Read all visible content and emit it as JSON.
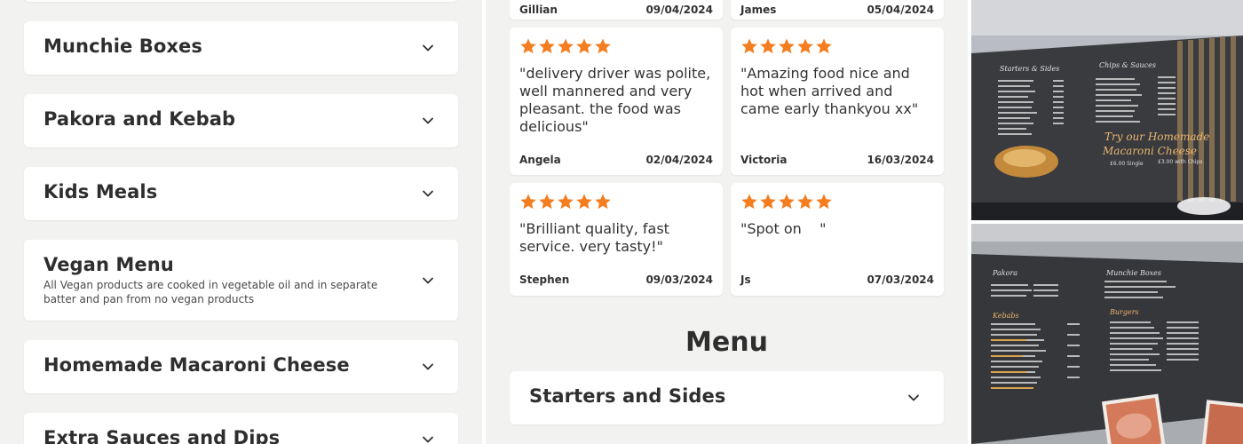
{
  "categories": [
    {
      "title": "Munchie Boxes"
    },
    {
      "title": "Pakora and Kebab"
    },
    {
      "title": "Kids Meals"
    },
    {
      "title": "Vegan Menu",
      "description": "All Vegan products are cooked in vegetable oil and in separate batter and pan from no vegan products"
    },
    {
      "title": "Homemade Macaroni Cheese"
    },
    {
      "title": "Extra Sauces and Dips"
    }
  ],
  "reviews": [
    {
      "name": "Gillian",
      "date": "09/04/2024"
    },
    {
      "name": "James",
      "date": "05/04/2024"
    },
    {
      "rating": 5,
      "text": "\"delivery driver was polite, well mannered and very pleasant. the food was delicious\"",
      "name": "Angela",
      "date": "02/04/2024"
    },
    {
      "rating": 5,
      "text": "\"Amazing food nice and hot when arrived and came early thankyou xx\"",
      "name": "Victoria",
      "date": "16/03/2024"
    },
    {
      "rating": 5,
      "text": "\"Brilliant quality, fast service. very tasty!\"",
      "name": "Stephen",
      "date": "09/03/2024"
    },
    {
      "rating": 5,
      "text": "\"Spot on    \"",
      "name": "Js",
      "date": "07/03/2024"
    }
  ],
  "menu_heading": "Menu",
  "menu_sections": [
    {
      "title": "Starters and Sides"
    }
  ],
  "photo_board_1": {
    "left_heading": "Starters & Sides",
    "right_heading": "Chips & Sauces",
    "promo_line1": "Try our Homemade",
    "promo_line2": "Macaroni Cheese",
    "promo_price1": "£6.00 Single",
    "promo_price2": "£3.00 with Chips"
  },
  "photo_board_2": {
    "heading_pakora": "Pakora",
    "heading_munchie": "Munchie Boxes",
    "heading_kebabs": "Kebabs",
    "heading_burgers": "Burgers"
  },
  "colors": {
    "star": "#f47d20",
    "page_bg": "#f2f2f0",
    "card_bg": "#ffffff",
    "text": "#2e2e2e"
  }
}
